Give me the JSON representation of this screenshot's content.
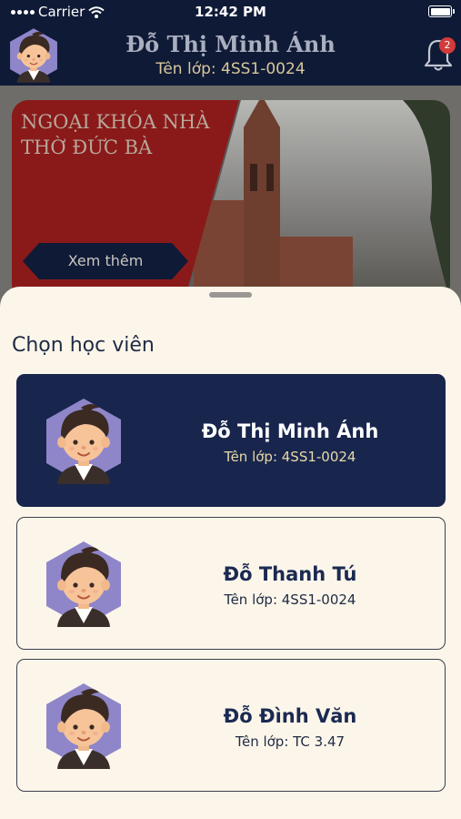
{
  "status_bar": {
    "carrier": "Carrier",
    "time": "12:42 PM"
  },
  "header": {
    "name": "Đỗ Thị Minh Ánh",
    "class_label": "Tên lớp: 4SS1-0024",
    "notification_count": "2"
  },
  "banner": {
    "title": "NGOẠI KHÓA NHÀ THỜ ĐỨC BÀ",
    "button_label": "Xem thêm"
  },
  "sheet": {
    "title": "Chọn học viên",
    "students": [
      {
        "name": "Đỗ Thị Minh Ánh",
        "class_label": "Tên lớp: 4SS1-0024",
        "selected": true
      },
      {
        "name": "Đỗ Thanh Tú",
        "class_label": "Tên lớp: 4SS1-0024",
        "selected": false
      },
      {
        "name": "Đỗ Đình Văn",
        "class_label": "Tên lớp: TC 3.47",
        "selected": false
      }
    ]
  },
  "colors": {
    "navy": "#0f1a36",
    "selected_card": "#18264e",
    "sheet_bg": "#fcf6ea",
    "gold_text": "#e9d8a6",
    "badge_red": "#d33a3a"
  }
}
